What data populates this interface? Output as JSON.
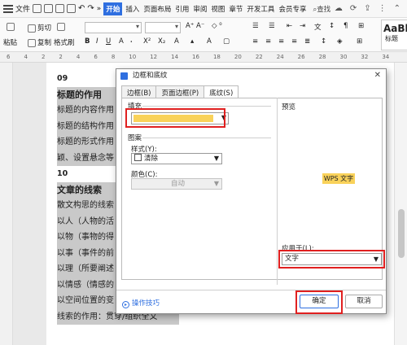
{
  "menubar": {
    "file": "文件",
    "tabs": [
      "开始",
      "插入",
      "页面布局",
      "引用",
      "审阅",
      "视图",
      "章节",
      "开发工具",
      "会员专享"
    ],
    "active_tab": "开始",
    "search": "查找"
  },
  "ribbon": {
    "cut": "剪切",
    "paste": "粘贴",
    "copy": "复制",
    "format_painter": "格式刷",
    "style_sample": "AaBl",
    "style_label": "标题"
  },
  "ruler": [
    "6",
    "4",
    "2",
    "2",
    "4",
    "6",
    "8",
    "10",
    "12",
    "14",
    "16",
    "18",
    "20",
    "22",
    "24",
    "26",
    "28",
    "30",
    "32",
    "34"
  ],
  "document": {
    "lines": [
      {
        "text": "09",
        "style": "num"
      },
      {
        "text": "标题的作用",
        "style": "hd-sel"
      },
      {
        "text": "标题的内容作用",
        "style": "sel"
      },
      {
        "text": "标题的结构作用",
        "style": "sel"
      },
      {
        "text": "标题的形式作用",
        "style": "sel"
      },
      {
        "text": "颖、设置悬念等",
        "style": "sel"
      },
      {
        "text": "10",
        "style": "num"
      },
      {
        "text": "文章的线索",
        "style": "hd-sel"
      },
      {
        "text": "散文构思的线索",
        "style": "sel"
      },
      {
        "text": "以人（人物的活",
        "style": "sel"
      },
      {
        "text": "以物（事物的得",
        "style": "sel"
      },
      {
        "text": "以事（事件的前",
        "style": "sel"
      },
      {
        "text": "以理（所要阐述",
        "style": "sel"
      },
      {
        "text": "以情感（情感的",
        "style": "sel"
      },
      {
        "text": "以空间位置的变",
        "style": "sel"
      },
      {
        "text": "线索的作用：贯穿/组织全文",
        "style": "sel"
      }
    ]
  },
  "dialog": {
    "title": "边框和底纹",
    "tabs": [
      "边框(B)",
      "页面边框(P)",
      "底纹(S)"
    ],
    "active_tab": "底纹(S)",
    "fill_label": "填充",
    "fill_color": "#f9d25a",
    "pattern_label": "图案",
    "style_label": "样式(Y):",
    "style_value": "清除",
    "color_label": "颜色(C):",
    "color_value": "自动",
    "preview_label": "预览",
    "preview_text": "WPS 文字",
    "apply_label": "应用于(L):",
    "apply_value": "文字",
    "tips": "操作技巧",
    "ok": "确定",
    "cancel": "取消"
  },
  "colors": {
    "accent": "#2f6fe0",
    "highlight_box": "#e02020",
    "fill": "#f9d25a",
    "selection": "#c9c9c9"
  }
}
